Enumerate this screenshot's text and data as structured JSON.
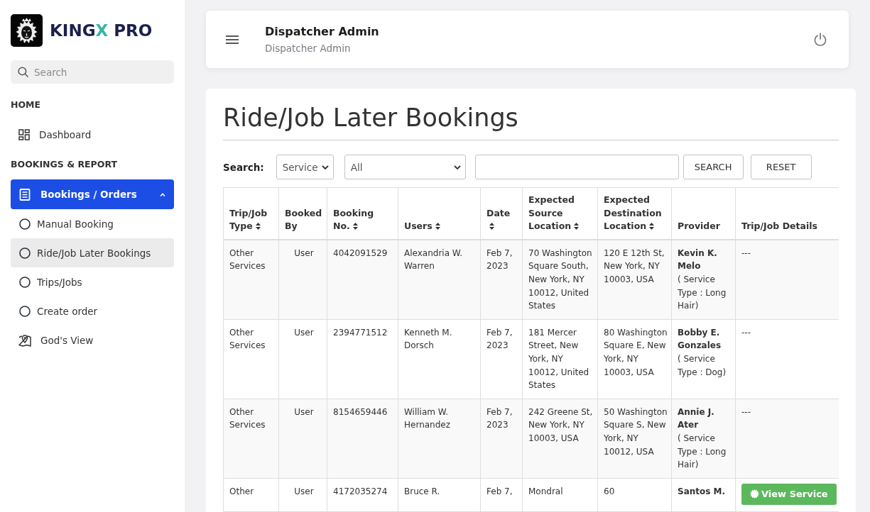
{
  "sidebar": {
    "logo": {
      "name_start": "KING",
      "name_accent": "X",
      "name_end": "PRO"
    },
    "search": {
      "placeholder": "Search"
    },
    "sections": [
      {
        "heading": "HOME",
        "items": [
          {
            "kind": "link",
            "label": "Dashboard",
            "selected": false
          }
        ]
      },
      {
        "heading": "BOOKINGS & REPORT",
        "items": [
          {
            "kind": "group",
            "label": "Bookings / Orders",
            "selected": true,
            "expanded": true,
            "children": [
              {
                "label": "Manual Booking",
                "selected": false
              },
              {
                "label": "Ride/Job Later Bookings",
                "selected": true
              },
              {
                "label": "Trips/Jobs",
                "selected": false
              },
              {
                "label": "Create order",
                "selected": false
              }
            ]
          },
          {
            "kind": "link",
            "label": "God's View",
            "selected": false
          }
        ]
      }
    ]
  },
  "header": {
    "title": "Dispatcher Admin",
    "subtitle": "Dispatcher Admin"
  },
  "page": {
    "title": "Ride/Job Later Bookings"
  },
  "filters": {
    "label": "Search:",
    "selects": [
      {
        "value": "Service"
      },
      {
        "value": "All"
      }
    ],
    "buttons": [
      {
        "label": "SEARCH"
      },
      {
        "label": "RESET"
      }
    ]
  },
  "table": {
    "columns": [
      {
        "label": "Trip/Job Type",
        "sortable": true
      },
      {
        "label": "Booked By",
        "sortable": false
      },
      {
        "label": "Booking No.",
        "sortable": true
      },
      {
        "label": "Users",
        "sortable": true
      },
      {
        "label": "Date",
        "sortable": true
      },
      {
        "label": "Expected Source Location",
        "sortable": true
      },
      {
        "label": "Expected Destination Location",
        "sortable": true
      },
      {
        "label": "Provider",
        "sortable": false
      },
      {
        "label": "Trip/Job Details",
        "sortable": false
      }
    ],
    "rows": [
      {
        "trip_type": "Other Services",
        "booked_by": "User",
        "booking_no": "4042091529",
        "user": "Alexandria W. Warren",
        "date": "Feb 7, 2023",
        "source": "70 Washington Square South, New York, NY 10012, United States",
        "destination": "120 E 12th St, New York, NY 10003, USA",
        "provider": {
          "name": "Kevin K. Melo",
          "service_type": "( Service Type : Long Hair)"
        },
        "details": {
          "kind": "text",
          "text": "---"
        }
      },
      {
        "trip_type": "Other Services",
        "booked_by": "User",
        "booking_no": "2394771512",
        "user": "Kenneth M. Dorsch",
        "date": "Feb 7, 2023",
        "source": "181 Mercer Street, New York, NY 10012, United States",
        "destination": "80 Washington Square E, New York, NY 10003, USA",
        "provider": {
          "name": "Bobby E. Gonzales",
          "service_type": "( Service Type : Dog)"
        },
        "details": {
          "kind": "text",
          "text": "---"
        }
      },
      {
        "trip_type": "Other Services",
        "booked_by": "User",
        "booking_no": "8154659446",
        "user": "William W. Hernandez",
        "date": "Feb 7, 2023",
        "source": "242 Greene St, New York, NY 10003, USA",
        "destination": "50 Washington Square S, New York, NY 10012, USA",
        "provider": {
          "name": "Annie J. Ater",
          "service_type": "( Service Type : Long Hair)"
        },
        "details": {
          "kind": "text",
          "text": "---"
        }
      },
      {
        "trip_type": "Other",
        "booked_by": "User",
        "booking_no": "4172035274",
        "user": "Bruce R.",
        "date": "Feb 7,",
        "source": "Mondral",
        "destination": "60",
        "provider": {
          "name": "Santos M."
        },
        "details": {
          "kind": "button",
          "label": "View Service"
        }
      }
    ]
  }
}
